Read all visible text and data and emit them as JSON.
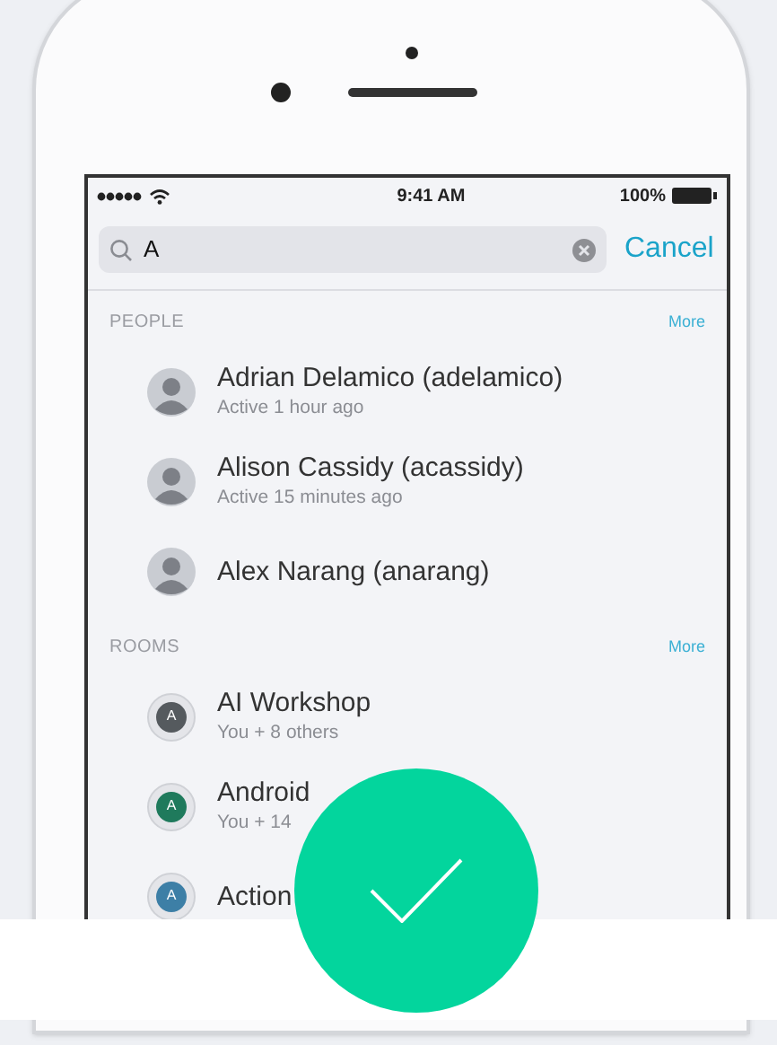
{
  "status_bar": {
    "time": "9:41 AM",
    "battery": "100%"
  },
  "search": {
    "value": "A",
    "cancel": "Cancel"
  },
  "sections": [
    {
      "title": "PEOPLE",
      "more": "More",
      "items": [
        {
          "kind": "person",
          "name": "Adrian Delamico (adelamico)",
          "subtitle": "Active 1 hour ago"
        },
        {
          "kind": "person",
          "name": "Alison Cassidy (acassidy)",
          "subtitle": "Active 15 minutes ago"
        },
        {
          "kind": "person",
          "name": "Alex Narang (anarang)"
        }
      ]
    },
    {
      "title": "ROOMS",
      "more": "More",
      "items": [
        {
          "kind": "room",
          "name": "AI Workshop",
          "subtitle": "You + 8 others",
          "initial": "A",
          "color": "#555a5e"
        },
        {
          "kind": "room",
          "name": "Android",
          "subtitle": "You + 14",
          "initial": "A",
          "color": "#1f7a5c"
        },
        {
          "kind": "room",
          "name": "Action",
          "initial": "A",
          "color": "#3d7fa6"
        }
      ]
    }
  ]
}
